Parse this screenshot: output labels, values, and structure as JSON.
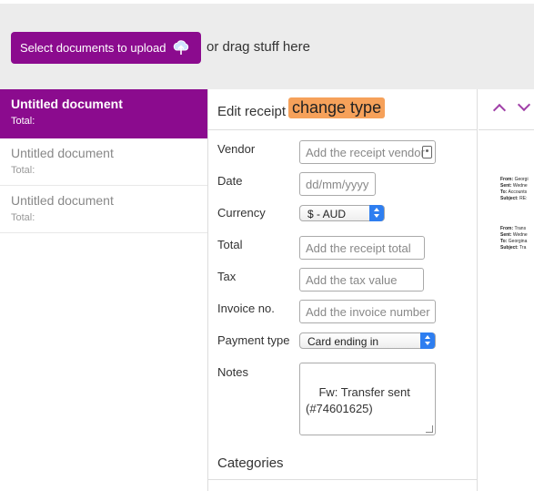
{
  "toolbar": {
    "upload_label": "Select documents to upload",
    "drag_text": "or drag stuff here"
  },
  "documents": [
    {
      "title": "Untitled document",
      "total": "Total:",
      "active": true
    },
    {
      "title": "Untitled document",
      "total": "Total:",
      "active": false
    },
    {
      "title": "Untitled document",
      "total": "Total:",
      "active": false
    }
  ],
  "form": {
    "header": "Edit receipt",
    "change_type": "change type",
    "vendor": {
      "label": "Vendor",
      "placeholder": "Add the receipt vendor"
    },
    "date": {
      "label": "Date",
      "placeholder": "dd/mm/yyyy"
    },
    "currency": {
      "label": "Currency",
      "value": "$ - AUD"
    },
    "total": {
      "label": "Total",
      "placeholder": "Add the receipt total"
    },
    "tax": {
      "label": "Tax",
      "placeholder": "Add the tax value"
    },
    "invoice": {
      "label": "Invoice no.",
      "placeholder": "Add the invoice number"
    },
    "payment": {
      "label": "Payment type",
      "value": "Card ending in"
    },
    "notes": {
      "label": "Notes",
      "value": "Fw: Transfer sent\n(#74601625)"
    },
    "categories_label": "Categories"
  },
  "preview": {
    "block1": [
      {
        "key": "From:",
        "val": "Georgi"
      },
      {
        "key": "Sent:",
        "val": "Wedne"
      },
      {
        "key": "To:",
        "val": "Accounts"
      },
      {
        "key": "Subject:",
        "val": "RE:"
      }
    ],
    "block2": [
      {
        "key": "From:",
        "val": "Trans"
      },
      {
        "key": "Sent:",
        "val": "Wedne"
      },
      {
        "key": "To:",
        "val": "Georgina"
      },
      {
        "key": "Subject:",
        "val": "Tra"
      }
    ]
  },
  "colors": {
    "brand": "#8b0b8e",
    "change_type": "#f6a15a",
    "select_accent": "#2e7ef0"
  }
}
